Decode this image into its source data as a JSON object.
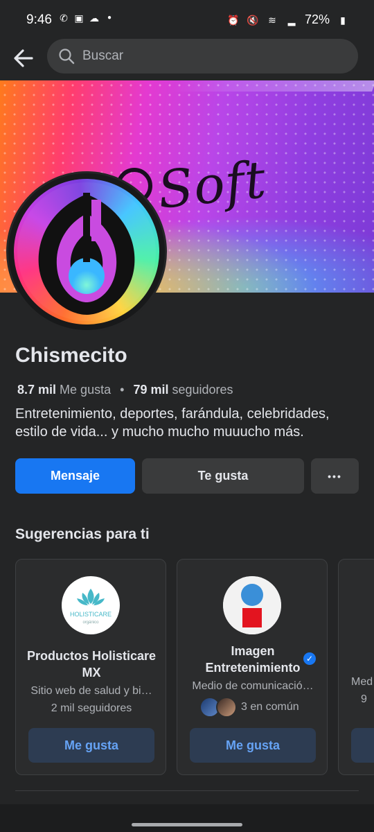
{
  "status_bar": {
    "time": "9:46",
    "battery": "72%"
  },
  "header": {
    "search_placeholder": "Buscar"
  },
  "page": {
    "cover_brand_text": "Soft",
    "name": "Chismecito",
    "likes_count": "8.7 mil",
    "likes_label": "Me gusta",
    "followers_count": "79 mil",
    "followers_label": "seguidores",
    "description": "Entretenimiento, deportes, farándula, celebridades, estilo de vida... y mucho mucho muuucho más."
  },
  "actions": {
    "message_label": "Mensaje",
    "like_label": "Te gusta",
    "more_label": "•••"
  },
  "suggestions": {
    "title": "Sugerencias para ti",
    "cards": [
      {
        "title": "Productos Holisticare MX",
        "logo_text": "HOLISTICARE",
        "logo_subtext": "orgánico",
        "subtitle": "Sitio web de salud y bi…",
        "detail": "2 mil seguidores",
        "button": "Me gusta"
      },
      {
        "title_line1": "Imagen",
        "title_line2": "Entretenimiento",
        "verified": true,
        "subtitle": "Medio de comunicació…",
        "detail": "3 en común",
        "button": "Me gusta"
      },
      {
        "subtitle": "Med",
        "detail": "9"
      }
    ]
  },
  "colors": {
    "background": "#242526",
    "primary": "#1877f2",
    "secondary_button": "#3a3b3c",
    "like_button_text": "#66a3f5"
  }
}
